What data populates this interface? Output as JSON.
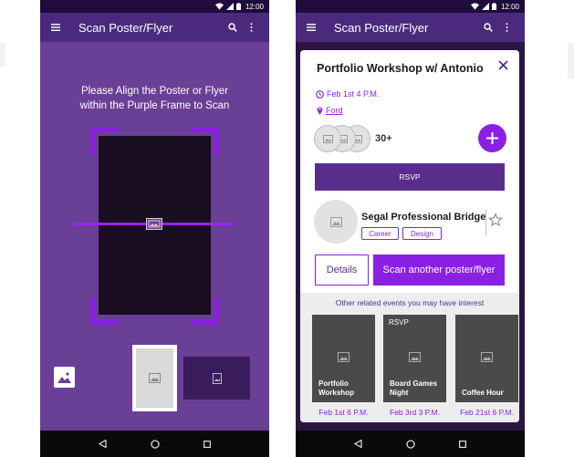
{
  "status_bar": {
    "time": "12:00"
  },
  "scan_screen": {
    "title": "Scan Poster/Flyer",
    "instructions_line1": "Please Align the Poster or Flyer",
    "instructions_line2": "within the Purple Frame to Scan"
  },
  "event_screen": {
    "title": "Scan Poster/Flyer",
    "event": {
      "name": "Portfolio Workshop w/ Antonio",
      "date": "Feb 1st 4 P.M.",
      "location": "Ford",
      "attendee_count": "30+"
    },
    "rsvp_label": "RSVP",
    "organizer": {
      "name": "Segal Professional Bridge",
      "tags": [
        "Career",
        "Design"
      ]
    },
    "details_label": "Details",
    "scan_another_label": "Scan another poster/flyer",
    "related_header": "Other related events you may have interest",
    "related": [
      {
        "top_label": "",
        "title": "Portfolio Workshop",
        "date": "Feb 1st  6 P.M."
      },
      {
        "top_label": "RSVP",
        "title": "Board Games Night",
        "date": "Feb 3rd  3 P.M."
      },
      {
        "top_label": "",
        "title": "Coffee Hour",
        "date": "Feb 21st  6 P.M."
      }
    ]
  },
  "colors": {
    "accent": "#8b1fe3",
    "app_bar": "#4b2a7d",
    "scan_background": "#6a3f96",
    "rsvp_button": "#5a2c8c"
  },
  "icons": {
    "menu": "hamburger-menu-icon",
    "search": "search-icon",
    "more": "more-vert-icon",
    "close": "close-icon",
    "calendar": "clock-icon",
    "location": "location-pin-icon",
    "add": "plus-icon",
    "star": "star-outline-icon",
    "image": "image-placeholder-icon"
  }
}
